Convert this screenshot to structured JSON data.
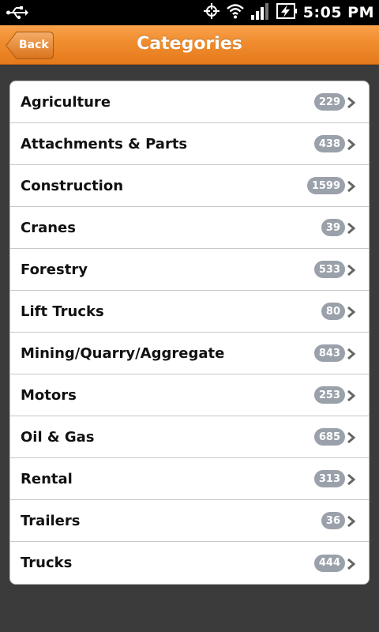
{
  "status_bar": {
    "time": "5:05 PM",
    "icons": [
      "usb-icon",
      "gps-icon",
      "wifi-icon",
      "signal-icon",
      "battery-charging-icon"
    ]
  },
  "header": {
    "back_label": "Back",
    "title": "Categories",
    "accent_color": "#f08c2e"
  },
  "categories": [
    {
      "label": "Agriculture",
      "count": "229"
    },
    {
      "label": "Attachments & Parts",
      "count": "438"
    },
    {
      "label": "Construction",
      "count": "1599"
    },
    {
      "label": "Cranes",
      "count": "39"
    },
    {
      "label": "Forestry",
      "count": "533"
    },
    {
      "label": "Lift Trucks",
      "count": "80"
    },
    {
      "label": "Mining/Quarry/Aggregate",
      "count": "843"
    },
    {
      "label": "Motors",
      "count": "253"
    },
    {
      "label": "Oil & Gas",
      "count": "685"
    },
    {
      "label": "Rental",
      "count": "313"
    },
    {
      "label": "Trailers",
      "count": "36"
    },
    {
      "label": "Trucks",
      "count": "444"
    }
  ]
}
